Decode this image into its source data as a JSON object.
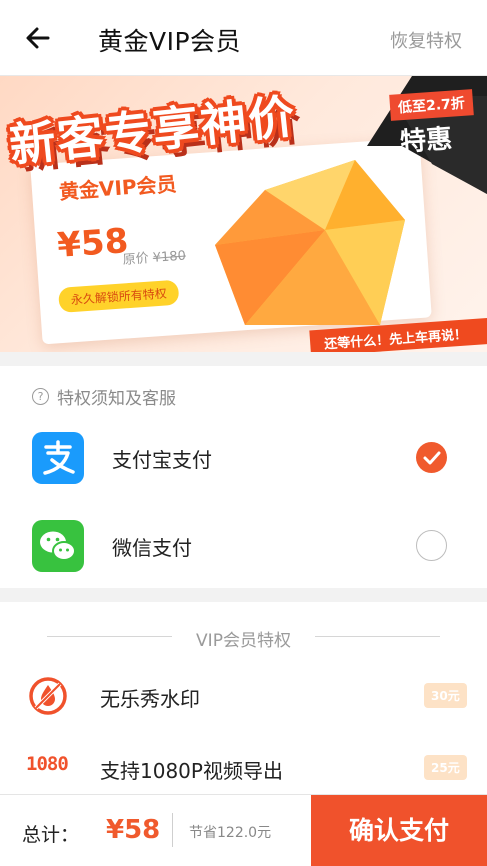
{
  "header": {
    "title": "黄金VIP会员",
    "restore_label": "恢复特权",
    "back_icon": "back-arrow-icon"
  },
  "banner": {
    "slogan": "新客专享神价",
    "badge_discount": "低至2.7折",
    "badge_special": "特惠",
    "card_title": "黄金VIP会员",
    "price": "¥58",
    "original_price_label": "原价",
    "original_price": "¥180",
    "pill": "永久解锁所有特权",
    "strip": "还等什么！先上车再说！"
  },
  "payment": {
    "notice": "特权须知及客服",
    "methods": [
      {
        "label": "支付宝支付",
        "icon": "alipay-icon",
        "selected": true
      },
      {
        "label": "微信支付",
        "icon": "wechat-pay-icon",
        "selected": false
      }
    ]
  },
  "vip": {
    "heading": "VIP会员特权",
    "privileges": [
      {
        "label": "无乐秀水印",
        "icon": "no-watermark-icon",
        "value": "30元"
      },
      {
        "label": "支持1080P视频导出",
        "icon": "1080p-icon",
        "icon_text": "1080",
        "value": "25元"
      }
    ]
  },
  "footer": {
    "total_label": "总计：",
    "total_price": "¥58",
    "saved": "节省122.0元",
    "confirm_label": "确认支付"
  },
  "colors": {
    "accent": "#f0522c",
    "alipay": "#1a9bfc",
    "wechat": "#38c23f",
    "gem": "#ffb23a"
  }
}
